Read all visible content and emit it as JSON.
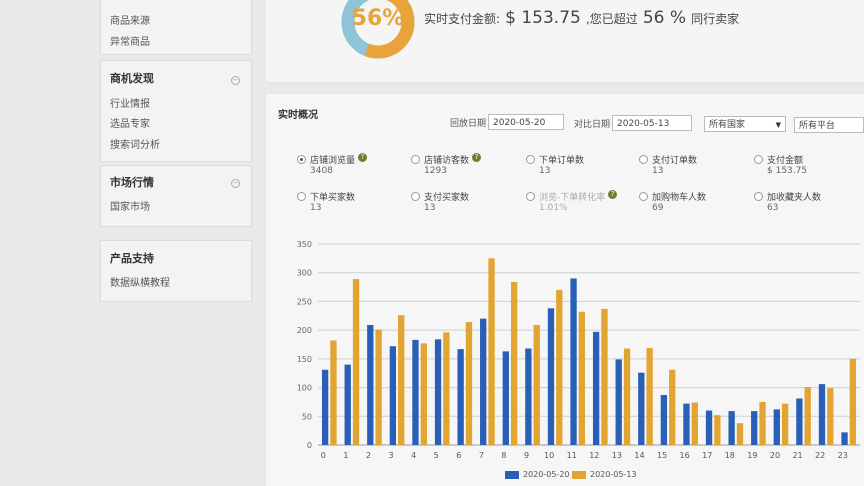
{
  "sidebar": {
    "items_top": [
      "商品来源",
      "异常商品"
    ],
    "section_opportunity": {
      "title": "商机发现",
      "toggle": "−",
      "items": [
        "行业情报",
        "选品专家",
        "搜索词分析"
      ]
    },
    "section_market": {
      "title": "市场行情",
      "toggle": "−",
      "items": [
        "国家市场"
      ]
    },
    "section_support": {
      "title": "产品支持",
      "items": [
        "数据纵横教程"
      ]
    }
  },
  "summary": {
    "percent_display": "56%",
    "percent_fraction": 0.56,
    "pay_label": "实时支付金额:",
    "pay_amount": "$ 153.75",
    "beat_label": ",您已超过",
    "beat_value": "56 %",
    "beat_suffix": "同行卖家",
    "colors": {
      "ring_fill": "#e8a43a",
      "ring_rest": "#8ec3d8"
    }
  },
  "realtime": {
    "title": "实时概况",
    "backtrack_label": "回放日期",
    "backtrack_date": "2020-05-20",
    "compare_label": "对比日期",
    "compare_date": "2020-05-13",
    "country_select": "所有国家",
    "platform_select": "所有平台"
  },
  "metrics": [
    {
      "label": "店铺浏览量",
      "value": "3408",
      "selected": true,
      "help": true,
      "disabled": false
    },
    {
      "label": "店铺访客数",
      "value": "1293",
      "selected": false,
      "help": true,
      "disabled": false
    },
    {
      "label": "下单订单数",
      "value": "13",
      "selected": false,
      "help": false,
      "disabled": false
    },
    {
      "label": "支付订单数",
      "value": "13",
      "selected": false,
      "help": false,
      "disabled": false
    },
    {
      "label": "支付金额",
      "value": "$ 153.75",
      "selected": false,
      "help": false,
      "disabled": false
    },
    {
      "label": "下单买家数",
      "value": "13",
      "selected": false,
      "help": false,
      "disabled": false
    },
    {
      "label": "支付买家数",
      "value": "13",
      "selected": false,
      "help": false,
      "disabled": false
    },
    {
      "label": "浏览-下单转化率",
      "value": "1.01%",
      "selected": false,
      "help": true,
      "disabled": true
    },
    {
      "label": "加购物车人数",
      "value": "69",
      "selected": false,
      "help": false,
      "disabled": false
    },
    {
      "label": "加收藏夹人数",
      "value": "63",
      "selected": false,
      "help": false,
      "disabled": false
    }
  ],
  "chart_data": {
    "type": "bar",
    "categories": [
      "0",
      "1",
      "2",
      "3",
      "4",
      "5",
      "6",
      "7",
      "8",
      "9",
      "10",
      "11",
      "12",
      "13",
      "14",
      "15",
      "16",
      "17",
      "18",
      "19",
      "20",
      "21",
      "22",
      "23"
    ],
    "series": [
      {
        "name": "2020-05-20",
        "color": "#2a5fb8",
        "values": [
          131,
          140,
          209,
          172,
          183,
          184,
          167,
          220,
          163,
          168,
          238,
          290,
          197,
          149,
          126,
          87,
          72,
          60,
          59,
          59,
          62,
          81,
          106,
          22
        ]
      },
      {
        "name": "2020-05-13",
        "color": "#e3a531",
        "values": [
          182,
          289,
          201,
          226,
          177,
          196,
          214,
          325,
          284,
          209,
          270,
          232,
          237,
          168,
          169,
          131,
          74,
          52,
          38,
          75,
          72,
          101,
          99,
          150
        ]
      }
    ],
    "ylim": [
      0,
      350
    ],
    "yticks": [
      0,
      50,
      100,
      150,
      200,
      250,
      300,
      350
    ],
    "grid": true,
    "legend": "bottom"
  }
}
